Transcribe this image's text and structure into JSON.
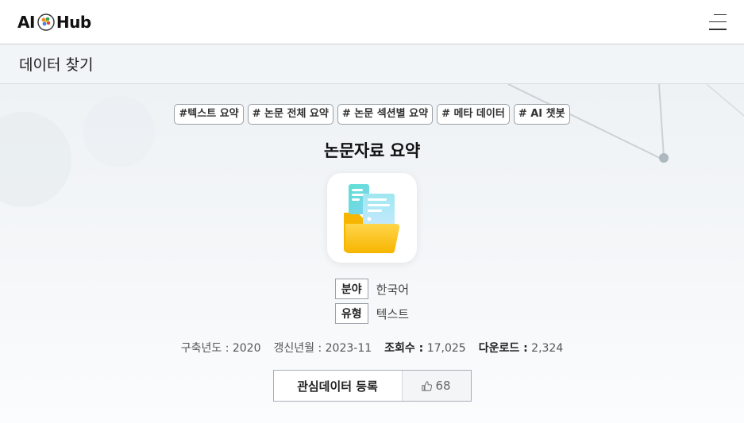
{
  "header": {
    "logo_left": "AI",
    "logo_right": "Hub",
    "menu_icon": "hamburger-menu-icon"
  },
  "subheader": {
    "title": "데이터 찾기"
  },
  "dataset": {
    "tags": [
      "#텍스트 요약",
      "# 논문 전체 요약",
      "# 논문 섹션별 요약",
      "# 메타 데이터",
      "# AI 챗봇"
    ],
    "title": "논문자료 요약",
    "icon": "folder-documents-icon",
    "field_label": "분야",
    "field_value": "한국어",
    "type_label": "유형",
    "type_value": "텍스트",
    "stats": {
      "built_year_label": "구축년도 :",
      "built_year": "2020",
      "updated_label": "갱신년월 :",
      "updated": "2023-11",
      "views_label": "조회수 :",
      "views": "17,025",
      "downloads_label": "다운로드 :",
      "downloads": "2,324"
    },
    "favorite_button": "관심데이터 등록",
    "like_count": "68"
  },
  "colors": {
    "accent_yellow": "#f7c21a",
    "accent_teal": "#5bd6cf",
    "subbar_bg": "#f1f5f8"
  }
}
